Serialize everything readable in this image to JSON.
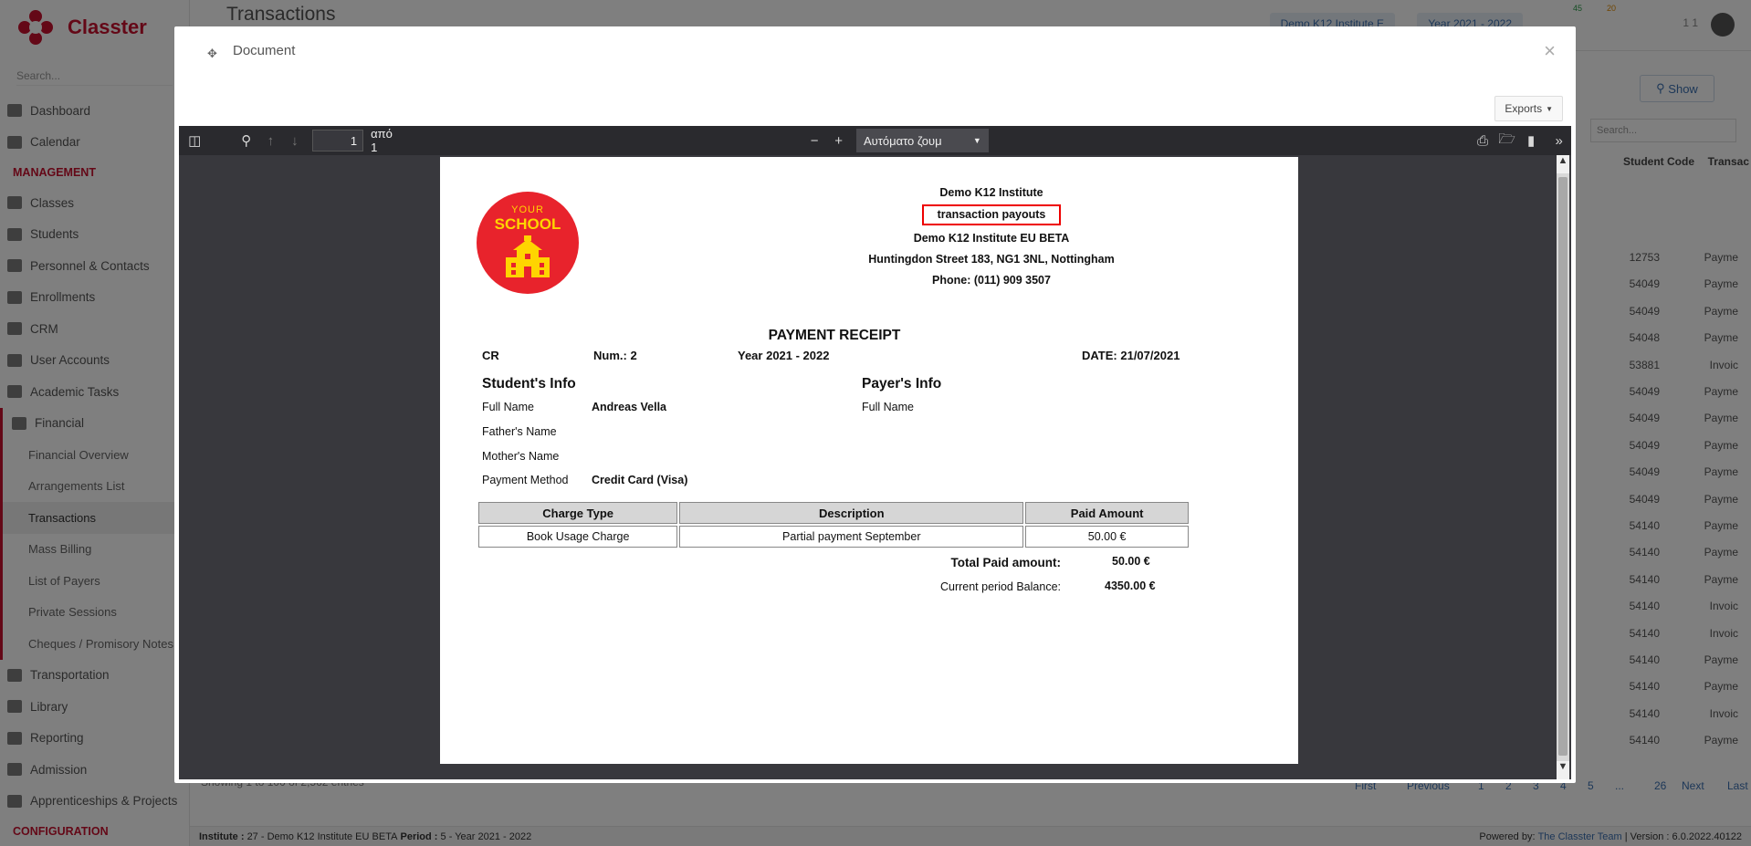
{
  "app": {
    "name": "Classter",
    "sidebar_search_placeholder": "Search...",
    "page_title": "Transactions",
    "institute_chip": "Demo K12 Institute E",
    "year_chip": "Year 2021 - 2022",
    "badge_messages": "45",
    "badge_mail": "20",
    "user_short": "1 1"
  },
  "sidebar": {
    "items": [
      {
        "label": "Dashboard"
      },
      {
        "label": "Calendar"
      }
    ],
    "management_label": "MANAGEMENT",
    "management_items": [
      {
        "label": "Classes"
      },
      {
        "label": "Students"
      },
      {
        "label": "Personnel & Contacts"
      },
      {
        "label": "Enrollments"
      },
      {
        "label": "CRM"
      },
      {
        "label": "User Accounts"
      },
      {
        "label": "Academic Tasks"
      },
      {
        "label": "Financial"
      }
    ],
    "financial_sub": [
      {
        "label": "Financial Overview"
      },
      {
        "label": "Arrangements List"
      },
      {
        "label": "Transactions"
      },
      {
        "label": "Mass Billing"
      },
      {
        "label": "List of Payers"
      },
      {
        "label": "Private Sessions"
      },
      {
        "label": "Cheques / Promisory Notes"
      }
    ],
    "more_items": [
      {
        "label": "Transportation"
      },
      {
        "label": "Library"
      },
      {
        "label": "Reporting"
      },
      {
        "label": "Admission"
      },
      {
        "label": "Apprenticeships & Projects"
      }
    ],
    "configuration_label": "CONFIGURATION"
  },
  "background_table": {
    "show_label": "Show",
    "search_placeholder": "Search...",
    "col_student_code": "Student Code",
    "col_transaction": "Transac",
    "rows": [
      {
        "code": "12753",
        "type": "Payme"
      },
      {
        "code": "54049",
        "type": "Payme"
      },
      {
        "code": "54049",
        "type": "Payme"
      },
      {
        "code": "54048",
        "type": "Payme"
      },
      {
        "code": "53881",
        "type": "Invoic"
      },
      {
        "code": "54049",
        "type": "Payme"
      },
      {
        "code": "54049",
        "type": "Payme"
      },
      {
        "code": "54049",
        "type": "Payme"
      },
      {
        "code": "54049",
        "type": "Payme"
      },
      {
        "code": "54049",
        "type": "Payme"
      },
      {
        "code": "54140",
        "type": "Payme"
      },
      {
        "code": "54140",
        "type": "Payme"
      },
      {
        "code": "54140",
        "type": "Payme"
      },
      {
        "code": "54140",
        "type": "Invoic"
      },
      {
        "code": "54140",
        "type": "Invoic"
      },
      {
        "code": "54140",
        "type": "Payme"
      },
      {
        "code": "54140",
        "type": "Payme"
      },
      {
        "code": "54140",
        "type": "Invoic"
      },
      {
        "code": "54140",
        "type": "Payme"
      }
    ],
    "entries_text": "Showing 1 to 100 of 2,562 entries",
    "pager": [
      "First",
      "Previous",
      "1",
      "2",
      "3",
      "4",
      "5",
      "...",
      "26",
      "Next",
      "Last"
    ]
  },
  "footer": {
    "institute_label": "Institute :",
    "institute_value": "27 - Demo K12 Institute EU BETA",
    "period_label": "Period :",
    "period_value": "5 - Year 2021 - 2022",
    "powered_by": "Powered by:",
    "team": "The Classter Team",
    "version": "| Version : 6.0.2022.40122"
  },
  "modal": {
    "title": "Document",
    "close_symbol": "×",
    "exports_label": "Exports"
  },
  "viewer": {
    "page_number": "1",
    "of_label": "από 1",
    "zoom_label": "Αυτόματο ζουμ"
  },
  "receipt": {
    "logo_top": "YOUR",
    "logo_main": "SCHOOL",
    "institute": "Demo K12 Institute",
    "subtitle": "transaction payouts",
    "institute_full": "Demo K12 Institute EU BETA",
    "address": "Huntingdon Street 183, NG1 3NL, Nottingham",
    "phone": "Phone: (011) 909 3507",
    "title": "PAYMENT RECEIPT",
    "series": "CR",
    "number": "Num.: 2",
    "year": "Year 2021 - 2022",
    "date": "DATE: 21/07/2021",
    "student_heading": "Student's Info",
    "payer_heading": "Payer's Info",
    "full_name_label": "Full Name",
    "full_name_value": "Andreas Vella",
    "father_label": "Father's Name",
    "mother_label": "Mother's Name",
    "method_label": "Payment Method",
    "method_value": "Credit Card (Visa)",
    "payer_full_name_label": "Full Name",
    "table_headers": [
      "Charge Type",
      "Description",
      "Paid  Amount"
    ],
    "table_row": [
      "Book Usage Charge",
      "Partial payment September",
      "50.00 €"
    ],
    "total_label": "Total Paid amount:",
    "total_value": "50.00 €",
    "balance_label": "Current period Balance:",
    "balance_value": "4350.00 €"
  }
}
